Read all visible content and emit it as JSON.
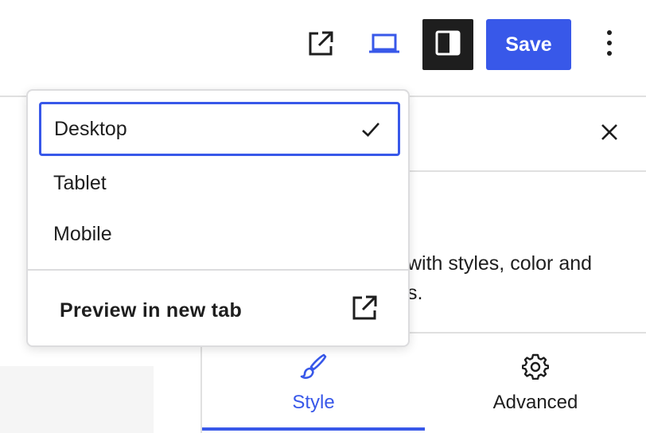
{
  "toolbar": {
    "view_page_icon": "external-link-icon",
    "device_icon": "desktop-icon",
    "settings_icon": "sidebar-toggle-icon",
    "save_label": "Save",
    "more_icon": "more-vertical-icon",
    "accent_color": "#3858e9"
  },
  "sidebar": {
    "close_icon": "close-icon",
    "description_line1": "with styles, color and",
    "description_line2": "s.",
    "tabs": [
      {
        "label": "Style",
        "icon": "brush-icon",
        "active": true
      },
      {
        "label": "Advanced",
        "icon": "gear-icon",
        "active": false
      }
    ]
  },
  "device_menu": {
    "items": [
      {
        "label": "Desktop",
        "selected": true,
        "icon": "check-icon"
      },
      {
        "label": "Tablet",
        "selected": false
      },
      {
        "label": "Mobile",
        "selected": false
      }
    ],
    "preview": {
      "label": "Preview in new tab",
      "icon": "external-link-icon"
    }
  }
}
